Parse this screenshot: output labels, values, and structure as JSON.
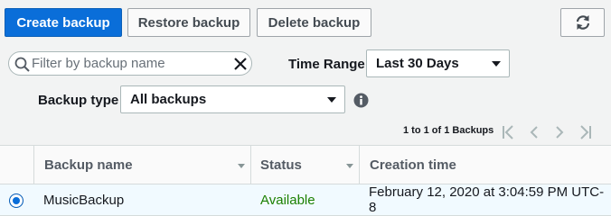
{
  "toolbar": {
    "create_label": "Create backup",
    "restore_label": "Restore backup",
    "delete_label": "Delete backup",
    "refresh_icon": "refresh-icon"
  },
  "filter": {
    "search_placeholder": "Filter by backup name",
    "search_value": "",
    "time_range_label": "Time Range",
    "time_range_value": "Last 30 Days",
    "backup_type_label": "Backup type",
    "backup_type_value": "All backups"
  },
  "pagination": {
    "summary": "1 to 1 of 1 Backups"
  },
  "table": {
    "columns": [
      "Backup name",
      "Status",
      "Creation time"
    ],
    "rows": [
      {
        "selected": true,
        "name": "MusicBackup",
        "status": "Available",
        "creation_time": "February 12, 2020 at 3:04:59 PM UTC-8"
      }
    ]
  },
  "colors": {
    "primary": "#0a6ed9",
    "status_available": "#1d8102",
    "selected_row": "#f1faff"
  }
}
